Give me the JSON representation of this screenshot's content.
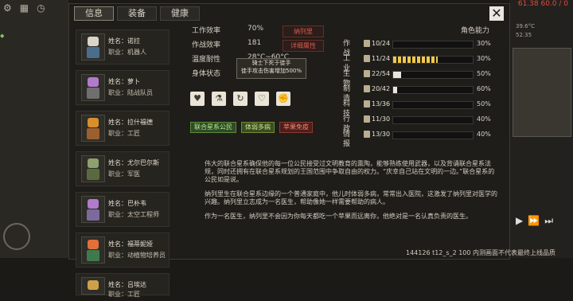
{
  "topbar": {
    "red_text": "61.38 60.0 / 0"
  },
  "side_right": {
    "weather": "39.6°C",
    "line2": "52.35"
  },
  "tabs": [
    {
      "label": "信息"
    },
    {
      "label": "装备"
    },
    {
      "label": "健康"
    }
  ],
  "characters": [
    {
      "name": "姓名：诺拉",
      "job": "职业：机器人",
      "hair": "#d9d3c8",
      "outfit": "#4a6d8c"
    },
    {
      "name": "姓名：萝卜",
      "job": "职业：陆战队员",
      "hair": "#b27acb",
      "outfit": "#6f6f6f"
    },
    {
      "name": "姓名：拉什福德",
      "job": "职业：工匠",
      "hair": "#d88f2c",
      "outfit": "#9c5f2d"
    },
    {
      "name": "姓名：尤尔巴尔斯",
      "job": "职业：军医",
      "hair": "#8ea06c",
      "outfit": "#5b6a3e"
    },
    {
      "name": "姓名：巴朴韦",
      "job": "职业：太空工程师",
      "hair": "#b27acb",
      "outfit": "#7b6a9c"
    },
    {
      "name": "姓名：福蒂妮娅",
      "job": "职业：动植物培养员",
      "hair": "#e2703a",
      "outfit": "#3e7a4d"
    },
    {
      "name": "姓名：吕埃达",
      "job": "职业：工匠",
      "hair": "#cfa04a",
      "outfit": "#8a6a3a"
    }
  ],
  "stats": {
    "work_label": "工作效率",
    "work_value": "70%",
    "combat_label": "作战效率",
    "combat_value": "181",
    "temp_label": "温度耐性",
    "temp_value": "28°C~60°C",
    "body_label": "身体状态",
    "link_name": "纳列里",
    "link_details": "详细属性"
  },
  "tooltip": {
    "line1": "骑士下死于徒手",
    "line2": "徒手攻击伤害增加500%"
  },
  "trait_icons": [
    "heart-star-icon",
    "bottle-icon",
    "cycle-icon",
    "heart-plus-icon",
    "fist-icon"
  ],
  "tags": [
    "联合星系公民",
    "体弱多病",
    "苹果免疫"
  ],
  "abilities": {
    "title": "角色能力",
    "items": [
      {
        "name": "作战",
        "level": "10/24",
        "percent": "30%",
        "fill": 0,
        "style": "white"
      },
      {
        "name": "工业",
        "level": "11/24",
        "percent": "30%",
        "fill": 0.56,
        "style": "yellow"
      },
      {
        "name": "生物",
        "level": "22/54",
        "percent": "50%",
        "fill": 0.1,
        "style": "white"
      },
      {
        "name": "制造",
        "level": "20/42",
        "percent": "60%",
        "fill": 0.05,
        "style": "white"
      },
      {
        "name": "科技",
        "level": "13/36",
        "percent": "50%",
        "fill": 0,
        "style": "white"
      },
      {
        "name": "行政",
        "level": "11/30",
        "percent": "40%",
        "fill": 0,
        "style": "white"
      },
      {
        "name": "情报",
        "level": "13/30",
        "percent": "40%",
        "fill": 0,
        "style": "white"
      }
    ]
  },
  "description": {
    "p1": "伟大的联合星系确保他的每一位公民接受过文明教育的熏陶，能够熟练使用武器，以及背诵联合星系法规，同时还拥有在联合星系规划的王国范围中争取自由的权力。“庆幸自己站在文明的一边。”联合星系的公民如是说。",
    "p2": "纳列里生在联合星系边缘的一个普通家庭中，他儿时体弱多病，常常出入医院，这激发了纳列里对医学的兴趣。纳列里立志成为一名医生，帮助像她一样需要帮助的病人。",
    "p3": "作为一名医生，纳列里不会因为你每天都吃一个苹果而远离你，他绝对是一名认真负责的医生。"
  },
  "bottom": {
    "text": "144126 t12_s_2 100  内测画面不代表最终上线品质"
  }
}
